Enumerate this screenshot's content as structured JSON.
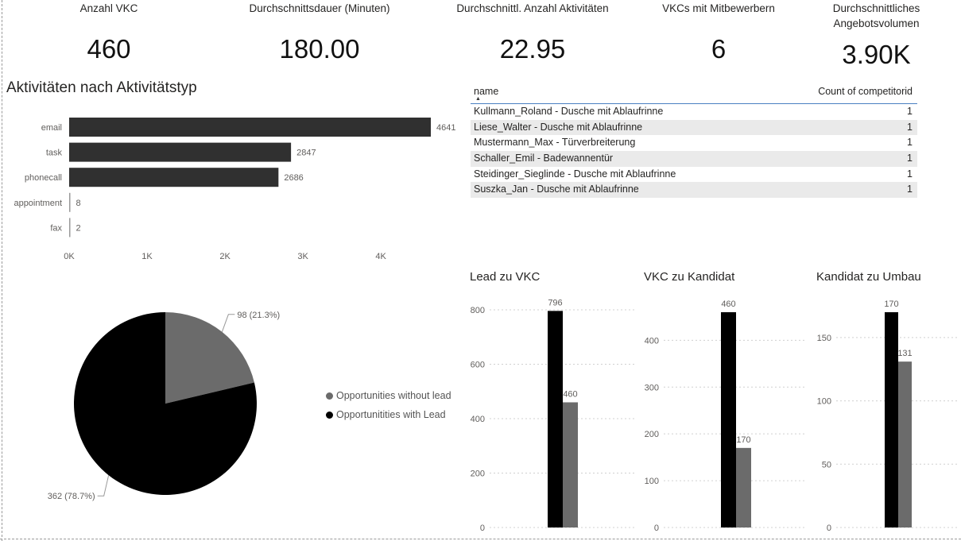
{
  "kpis": [
    {
      "label": "Anzahl VKC",
      "value": "460"
    },
    {
      "label": "Durchschnittsdauer (Minuten)",
      "value": "180.00"
    },
    {
      "label": "Durchschnittl. Anzahl Aktivitäten",
      "value": "22.95"
    },
    {
      "label": "VKCs mit Mitbewerbern",
      "value": "6"
    },
    {
      "label": "Durchschnittliches Angebotsvolumen",
      "value": "3.90K"
    }
  ],
  "table": {
    "columns": [
      "name",
      "Count of competitorid"
    ],
    "sort_indicator": "▲",
    "rows": [
      [
        "Kullmann_Roland - Dusche mit Ablaufrinne",
        "1"
      ],
      [
        "Liese_Walter - Dusche mit Ablaufrinne",
        "1"
      ],
      [
        "Mustermann_Max - Türverbreiterung",
        "1"
      ],
      [
        "Schaller_Emil - Badewannentür",
        "1"
      ],
      [
        "Steidinger_Sieglinde - Dusche mit Ablaufrinne",
        "1"
      ],
      [
        "Suszka_Jan - Dusche mit Ablaufrinne",
        "1"
      ]
    ]
  },
  "colors": {
    "dark": "#303030",
    "black": "#000000",
    "gray": "#6b6b6b",
    "table_line": "#4a7fc1"
  },
  "chart_data": [
    {
      "type": "bar",
      "orientation": "horizontal",
      "title": "Aktivitäten nach Aktivitätstyp",
      "categories": [
        "email",
        "task",
        "phonecall",
        "appointment",
        "fax"
      ],
      "values": [
        4641,
        2847,
        2686,
        8,
        2
      ],
      "xlim": [
        0,
        4700
      ],
      "xticks": [
        0,
        1000,
        2000,
        3000,
        4000
      ],
      "xtick_labels": [
        "0K",
        "1K",
        "2K",
        "3K",
        "4K"
      ],
      "color": "#303030"
    },
    {
      "type": "pie",
      "slices": [
        {
          "label": "Opportunities without lead",
          "value": 98,
          "data_label": "98 (21.3%)",
          "color": "#6b6b6b"
        },
        {
          "label": "Opportunitities with Lead",
          "value": 362,
          "data_label": "362 (78.7%)",
          "color": "#000000"
        }
      ],
      "legend_position": "right"
    },
    {
      "type": "bar",
      "title": "Lead zu VKC",
      "values": [
        796,
        460
      ],
      "colors": [
        "#000000",
        "#6b6b6b"
      ],
      "ylim": [
        0,
        800
      ],
      "yticks": [
        0,
        200,
        400,
        600,
        800
      ],
      "grid": true
    },
    {
      "type": "bar",
      "title": "VKC zu Kandidat",
      "values": [
        460,
        170
      ],
      "colors": [
        "#000000",
        "#6b6b6b"
      ],
      "ylim": [
        0,
        460
      ],
      "yticks": [
        0,
        100,
        200,
        300,
        400
      ],
      "grid": true
    },
    {
      "type": "bar",
      "title": "Kandidat zu Umbau",
      "values": [
        170,
        131
      ],
      "colors": [
        "#000000",
        "#6b6b6b"
      ],
      "ylim": [
        0,
        170
      ],
      "yticks": [
        0,
        50,
        100,
        150
      ],
      "grid": true
    }
  ]
}
